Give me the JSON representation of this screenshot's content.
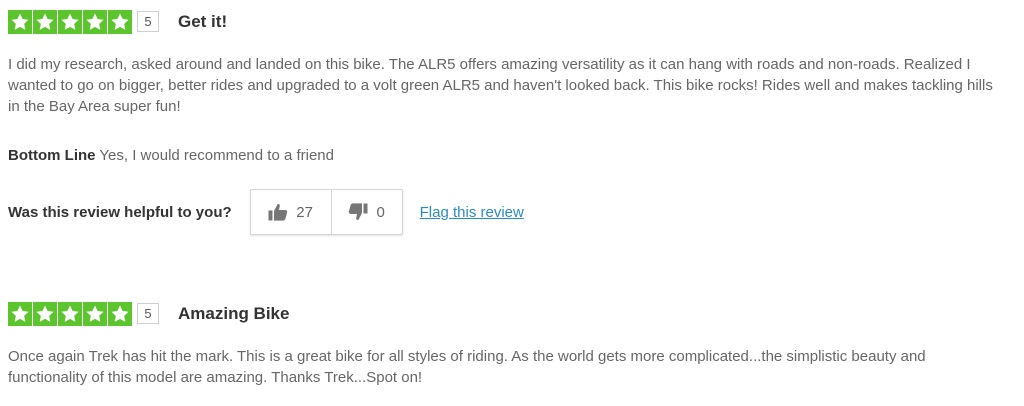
{
  "colors": {
    "star_green": "#5cc42d",
    "link_blue": "#2a8cc7",
    "title_text": "#333333",
    "body_text": "#666666"
  },
  "reviews": [
    {
      "rating": "5",
      "star_count": 5,
      "title": "Get it!",
      "body": "I did my research, asked around and landed on this bike. The ALR5 offers amazing versatility as it can hang with roads and non-roads. Realized I wanted to go on bigger, better rides and upgraded to a volt green ALR5 and haven't looked back. This bike rocks! Rides well and makes tackling hills in the Bay Area super fun!",
      "bottom_line_label": "Bottom Line",
      "bottom_line_text": "Yes, I would recommend to a friend",
      "helpful_question": "Was this review helpful to you?",
      "helpful_yes_count": "27",
      "helpful_no_count": "0",
      "flag_label": "Flag this review",
      "icons": {
        "star": "star-icon",
        "thumbs_up": "thumbs-up-icon",
        "thumbs_down": "thumbs-down-icon"
      }
    },
    {
      "rating": "5",
      "star_count": 5,
      "title": "Amazing Bike",
      "body": "Once again Trek has hit the mark. This is a great bike for all styles of riding. As the world gets more complicated...the simplistic beauty and functionality of this model are amazing. Thanks Trek...Spot on!"
    }
  ]
}
